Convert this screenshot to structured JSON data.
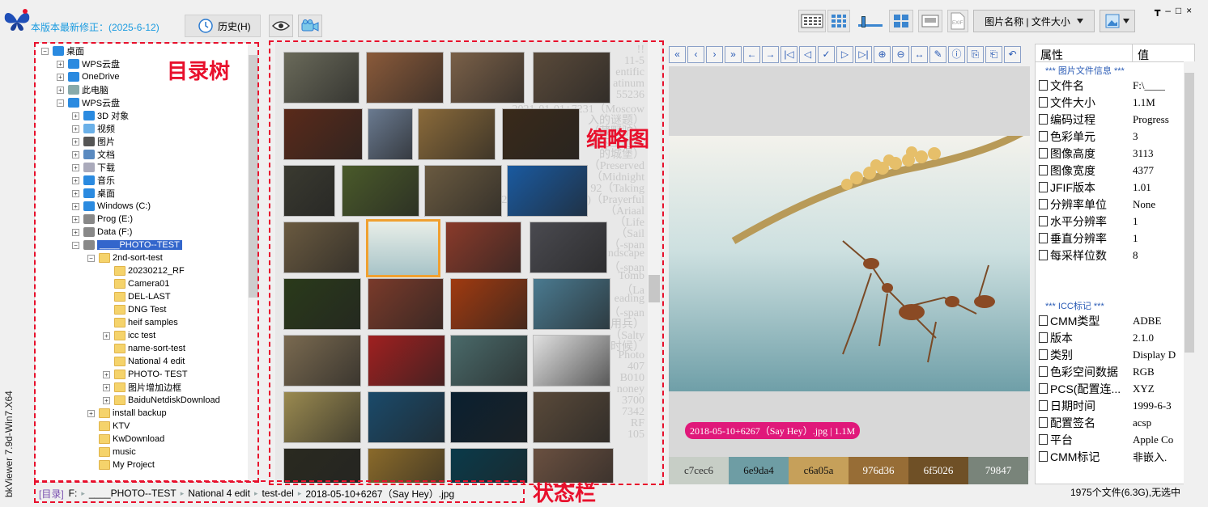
{
  "app": {
    "notice": "本版本最新修正：(2025-6-12)",
    "history_label": "历史(H)",
    "vertical_label": "bkViewer 7.9d-Win7.X64"
  },
  "toolbar": {
    "sort_label": "图片名称 | 文件大小"
  },
  "tree": {
    "title": "目录树",
    "items": [
      "桌面",
      "WPS云盘",
      "OneDrive",
      "此电脑",
      "WPS云盘",
      "3D 对象",
      "视频",
      "图片",
      "文档",
      "下载",
      "音乐",
      "桌面",
      "Windows (C:)",
      "Prog (E:)",
      "Data (F:)",
      "____PHOTO--TEST",
      "2nd-sort-test",
      "20230212_RF",
      "Camera01",
      "DEL-LAST",
      "DNG Test",
      "heif samples",
      "icc test",
      "name-sort-test",
      "National 4 edit",
      "PHOTO- TEST",
      "图片增加边框",
      "BaiduNetdiskDownload",
      "install backup",
      "KTV",
      "KwDownload",
      "music",
      "My Project"
    ]
  },
  "thumbs": {
    "title": "缩略图",
    "bg_text": [
      "!!",
      "11-5",
      "entific",
      "atinum",
      "55236",
      "2021-01-01+7231（Moscow",
      "入的谜题）",
      "（藏野驴）",
      "上的土地）",
      "的城堡）",
      "（Preserved",
      "（Midnight",
      "92（Taking",
      "2021-01-1+(46020)（Prayerful",
      "（Ariaal",
      "（Life",
      "（Sail",
      "（-span",
      "ndscape",
      "（-span",
      "Tomb",
      "（La",
      "eading",
      "（-span",
      "用兵）",
      "（Salty",
      "时候）",
      "Photo",
      "407",
      "B010",
      "noney",
      "3700",
      "7342",
      "RF",
      "105"
    ]
  },
  "viewer": {
    "file_badge": "2018-05-10+6267（Say Hey）.jpg | 1.1M",
    "palette": [
      {
        "hex": "c7cec6",
        "color": "#c7cec6",
        "fg": "#333"
      },
      {
        "hex": "6e9da4",
        "color": "#6e9da4",
        "fg": "#111"
      },
      {
        "hex": "c6a05a",
        "color": "#c6a05a",
        "fg": "#111"
      },
      {
        "hex": "976d36",
        "color": "#976d36",
        "fg": "#fff"
      },
      {
        "hex": "6f5026",
        "color": "#6f5026",
        "fg": "#fff"
      },
      {
        "hex": "79847",
        "color": "#79847a",
        "fg": "#fff"
      }
    ]
  },
  "props": {
    "head_key": "属性",
    "head_val": "值",
    "section1": "*** 图片文件信息 ***",
    "rows1": [
      [
        "文件名",
        "F:\\____"
      ],
      [
        "文件大小",
        "1.1M"
      ],
      [
        "编码过程",
        "Progress"
      ],
      [
        "色彩单元",
        "3"
      ],
      [
        "图像高度",
        "3113"
      ],
      [
        "图像宽度",
        "4377"
      ],
      [
        "JFIF版本",
        "1.01"
      ],
      [
        "分辨率单位",
        "None"
      ],
      [
        "水平分辨率",
        "1"
      ],
      [
        "垂直分辨率",
        "1"
      ],
      [
        "每采样位数",
        "8"
      ]
    ],
    "section2": "*** ICC标记 ***",
    "rows2": [
      [
        "CMM类型",
        "ADBE"
      ],
      [
        "版本",
        "2.1.0"
      ],
      [
        "类别",
        "Display D"
      ],
      [
        "色彩空间数据",
        "RGB"
      ],
      [
        "PCS(配置连...",
        "XYZ"
      ],
      [
        "日期时间",
        "1999-6-3"
      ],
      [
        "配置签名",
        "acsp"
      ],
      [
        "平台",
        "Apple Co"
      ],
      [
        "CMM标记",
        "非嵌入."
      ]
    ]
  },
  "status": {
    "prefix": "[目录]",
    "crumbs": [
      "F:",
      "____PHOTO--TEST",
      "National 4 edit",
      "test-del",
      "2018-05-10+6267（Say Hey）.jpg"
    ],
    "title": "状态栏",
    "count": "1975个文件(6.3G),无选中"
  }
}
